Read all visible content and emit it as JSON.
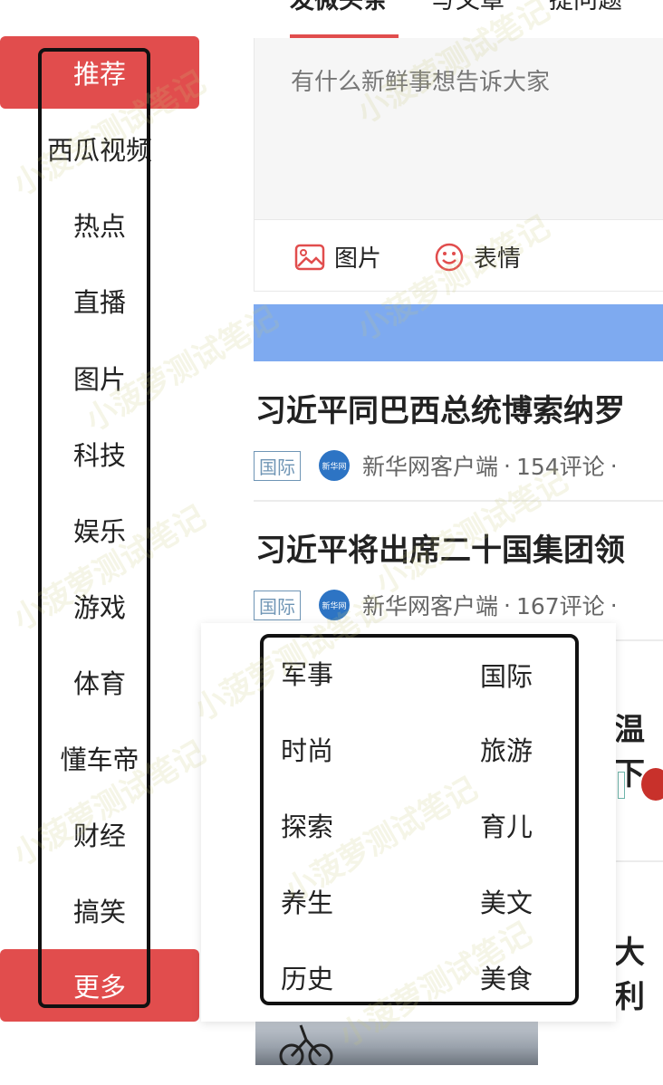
{
  "nav": {
    "items": [
      {
        "label": "推荐",
        "active": true
      },
      {
        "label": "西瓜视频"
      },
      {
        "label": "热点"
      },
      {
        "label": "直播"
      },
      {
        "label": "图片"
      },
      {
        "label": "科技"
      },
      {
        "label": "娱乐"
      },
      {
        "label": "游戏"
      },
      {
        "label": "体育"
      },
      {
        "label": "懂车帝"
      },
      {
        "label": "财经"
      },
      {
        "label": "搞笑"
      }
    ],
    "more_label": "更多"
  },
  "tabs": [
    {
      "label": "发微头条",
      "active": true
    },
    {
      "label": "写文章"
    },
    {
      "label": "提问题"
    }
  ],
  "composer": {
    "placeholder": "有什么新鲜事想告诉大家",
    "image_label": "图片",
    "emoji_label": "表情"
  },
  "articles": [
    {
      "title": "习近平同巴西总统博索纳罗",
      "tag": "国际",
      "source_logo": "新华网",
      "source": "新华网客户端",
      "comments": "154评论",
      "dot": "·"
    },
    {
      "title": "习近平将出席二十国集团领",
      "tag": "国际",
      "source_logo": "新华网",
      "source": "新华网客户端",
      "comments": "167评论",
      "dot": "·"
    }
  ],
  "partial_titles": [
    "温下",
    "大利"
  ],
  "more_menu": {
    "items": [
      "军事",
      "国际",
      "时尚",
      "旅游",
      "探索",
      "育儿",
      "养生",
      "美文",
      "历史",
      "美食"
    ]
  },
  "watermark": "小菠萝测试笔记",
  "colors": {
    "accent": "#e14d4d",
    "banner": "#7eaaf0",
    "tag": "#6f95b5"
  }
}
